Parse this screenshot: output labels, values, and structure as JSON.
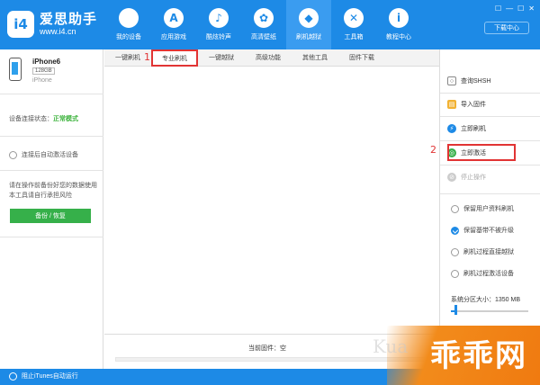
{
  "header": {
    "logo_badge": "i4",
    "logo_name": "爱思助手",
    "logo_url": "www.i4.cn",
    "nav": [
      {
        "label": "我的设备",
        "icon": "apple-icon",
        "glyph": "",
        "active": false
      },
      {
        "label": "应用游戏",
        "icon": "appstore-icon",
        "glyph": "A",
        "active": false
      },
      {
        "label": "酷炫铃声",
        "icon": "bell-icon",
        "glyph": "♪",
        "active": false
      },
      {
        "label": "高清壁纸",
        "icon": "flower-icon",
        "glyph": "✿",
        "active": false
      },
      {
        "label": "刷机越狱",
        "icon": "dropbox-icon",
        "glyph": "◆",
        "active": true
      },
      {
        "label": "工具箱",
        "icon": "tools-icon",
        "glyph": "✕",
        "active": false
      },
      {
        "label": "教程中心",
        "icon": "info-icon",
        "glyph": "i",
        "active": false
      }
    ],
    "window_controls": [
      "☐",
      "—",
      "☐",
      "✕"
    ],
    "download_label": "下载中心"
  },
  "device": {
    "name": "iPhone6",
    "capacity": "128GB",
    "model": "iPhone"
  },
  "left": {
    "conn_label": "设备连接状态：",
    "conn_value": "正常模式",
    "auto_activate": "连接后自动激活设备",
    "warning": "请在操作前备份好您的数据使用本工具请自行承担风险",
    "backup_button": "备份 / 恢复"
  },
  "tabs": [
    {
      "label": "一键刷机",
      "active": false
    },
    {
      "label": "专业刷机",
      "active": true
    },
    {
      "label": "一键越狱",
      "active": false
    },
    {
      "label": "高级功能",
      "active": false
    },
    {
      "label": "其他工具",
      "active": false
    },
    {
      "label": "固件下载",
      "active": false
    }
  ],
  "markers": {
    "one": "1",
    "two": "2"
  },
  "firmware": {
    "label": "当前固件：空"
  },
  "right": {
    "actions": [
      {
        "label": "查询SHSH",
        "icon": "search-icon",
        "glyph": "🔍",
        "color": "#ffffff",
        "disabled": false
      },
      {
        "label": "导入固件",
        "icon": "folder-icon",
        "glyph": "▤",
        "color": "#f2b233",
        "disabled": false
      },
      {
        "label": "立即刷机",
        "icon": "flash-icon",
        "glyph": "⚡",
        "color": "#1d8ae6",
        "disabled": false
      },
      {
        "label": "立即激活",
        "icon": "activate-icon",
        "glyph": "◎",
        "color": "#36b04a",
        "disabled": false
      },
      {
        "label": "停止操作",
        "icon": "stop-icon",
        "glyph": "⊘",
        "color": "#cccccc",
        "disabled": true
      }
    ],
    "options": [
      {
        "label": "保留用户资料刷机",
        "checked": false
      },
      {
        "label": "保留基带不被升级",
        "checked": true
      },
      {
        "label": "刷机过程直接越狱",
        "checked": false
      },
      {
        "label": "刷机过程激活设备",
        "checked": false
      }
    ],
    "partition_label": "系统分区大小：1350 MB"
  },
  "statusbar": {
    "itunes_label": "阻止iTunes自动运行"
  },
  "watermark": {
    "main": "乖乖网",
    "faint": "Kua"
  },
  "colors": {
    "brand": "#1d8ae6",
    "highlight": "#e13434",
    "ok": "#3bb23b",
    "backup": "#36b04a"
  }
}
